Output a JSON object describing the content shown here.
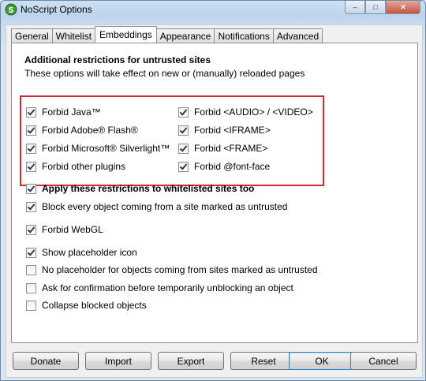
{
  "window": {
    "title": "NoScript Options",
    "icon": "noscript-s-icon"
  },
  "titlebar_buttons": {
    "minimize": "–",
    "maximize": "□",
    "close": "✕"
  },
  "tabs": [
    {
      "label": "General",
      "active": false
    },
    {
      "label": "Whitelist",
      "active": false
    },
    {
      "label": "Embeddings",
      "active": true
    },
    {
      "label": "Appearance",
      "active": false
    },
    {
      "label": "Notifications",
      "active": false
    },
    {
      "label": "Advanced",
      "active": false
    }
  ],
  "panel": {
    "heading": "Additional restrictions for untrusted sites",
    "note": "These options will take effect on new or (manually) reloaded pages",
    "restrictions_left": [
      {
        "label": "Forbid Java™",
        "checked": true
      },
      {
        "label": "Forbid Adobe® Flash®",
        "checked": true
      },
      {
        "label": "Forbid Microsoft® Silverlight™",
        "checked": true
      },
      {
        "label": "Forbid other plugins",
        "checked": true
      }
    ],
    "restrictions_right": [
      {
        "label": "Forbid <AUDIO> / <VIDEO>",
        "checked": true
      },
      {
        "label": "Forbid <IFRAME>",
        "checked": true
      },
      {
        "label": "Forbid <FRAME>",
        "checked": true
      },
      {
        "label": "Forbid @font-face",
        "checked": true
      }
    ],
    "options": [
      {
        "label": "Apply these restrictions to whitelisted sites too",
        "checked": true,
        "bold": true
      },
      {
        "label": "Block every object coming from a site marked as untrusted",
        "checked": true
      },
      {
        "label": "Forbid WebGL",
        "checked": true
      },
      {
        "label": "Show placeholder icon",
        "checked": true
      },
      {
        "label": "No placeholder for objects coming from sites marked as untrusted",
        "checked": false
      },
      {
        "label": "Ask for confirmation before temporarily unblocking an object",
        "checked": false
      },
      {
        "label": "Collapse blocked objects",
        "checked": false
      }
    ]
  },
  "buttons": {
    "donate": "Donate",
    "import": "Import",
    "export": "Export",
    "reset": "Reset",
    "ok": "OK",
    "cancel": "Cancel"
  },
  "colors": {
    "highlight_box": "#d9282f",
    "title_bar": "#bcd3ea"
  }
}
